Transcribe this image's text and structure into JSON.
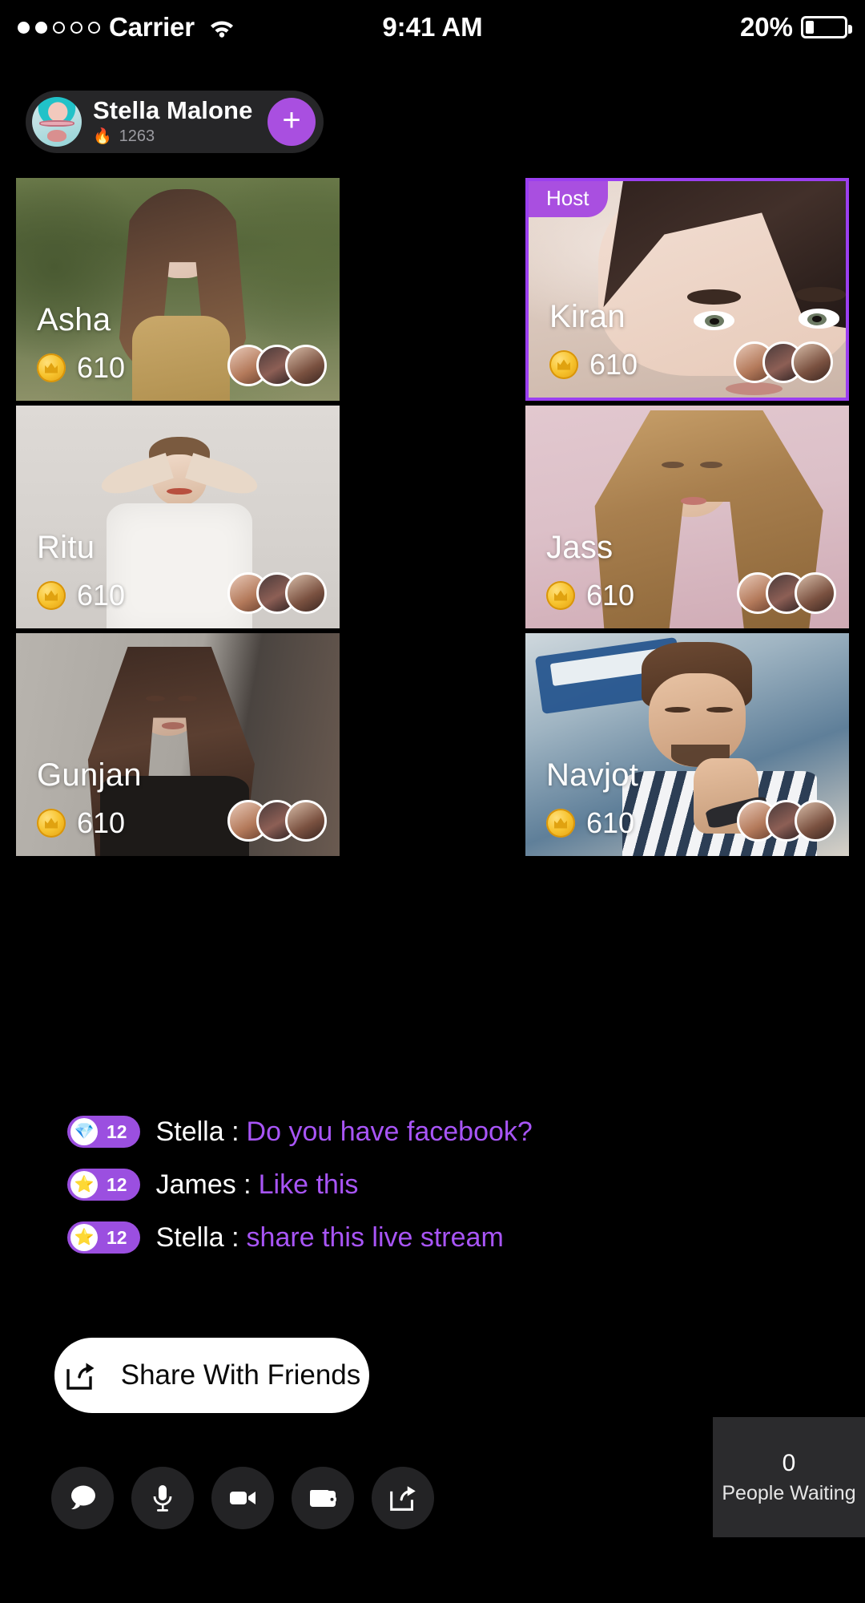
{
  "status_bar": {
    "signal_dots_filled": 2,
    "signal_dots_total": 5,
    "carrier": "Carrier",
    "wifi_icon": "wifi-icon",
    "time": "9:41 AM",
    "battery_percent": "20%",
    "battery_icon": "battery-icon"
  },
  "header": {
    "avatar_icon": "user-avatar",
    "name": "Stella Malone",
    "flame_icon": "flame-icon",
    "flame_count": "1263",
    "add_button_label": "+",
    "accent_color": "#a94fe0"
  },
  "grid": {
    "host_badge_label": "Host",
    "coin_icon": "coin-icon",
    "tiles": [
      {
        "name": "Asha",
        "coins": "610",
        "host": false
      },
      {
        "name": "Kiran",
        "coins": "610",
        "host": true
      },
      {
        "name": "Ritu",
        "coins": "610",
        "host": false
      },
      {
        "name": "Jass",
        "coins": "610",
        "host": false
      },
      {
        "name": "Gunjan",
        "coins": "610",
        "host": false
      },
      {
        "name": "Navjot",
        "coins": "610",
        "host": false
      }
    ]
  },
  "chat": {
    "messages": [
      {
        "badge_icon": "gem-icon",
        "badge_count": "12",
        "user": "Stella :",
        "text": "Do you have facebook?"
      },
      {
        "badge_icon": "star-icon",
        "badge_count": "12",
        "user": "James :",
        "text": "Like this"
      },
      {
        "badge_icon": "star-icon",
        "badge_count": "12",
        "user": "Stella :",
        "text": "share this live stream"
      }
    ],
    "username_color": "#ffffff",
    "message_color": "#a855f7",
    "badge_color": "#9b4fe0"
  },
  "share_button": {
    "icon": "share-icon",
    "label": "Share With Friends"
  },
  "bottom_bar": {
    "buttons": [
      {
        "icon": "chat-bubble-icon"
      },
      {
        "icon": "microphone-icon"
      },
      {
        "icon": "video-camera-icon"
      },
      {
        "icon": "wallet-icon"
      },
      {
        "icon": "share-icon"
      }
    ]
  },
  "waiting_panel": {
    "count": "0",
    "label": "People Waiting"
  }
}
